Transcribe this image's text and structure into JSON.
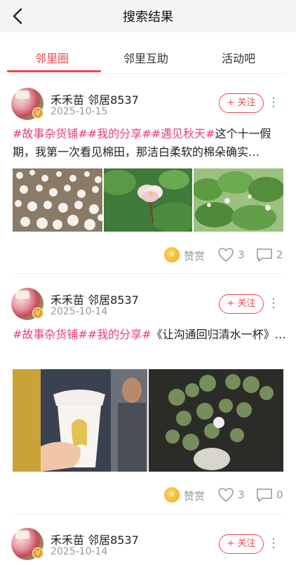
{
  "header": {
    "title": "搜索结果"
  },
  "tabs": [
    {
      "label": "邻里圈"
    },
    {
      "label": "邻里互助"
    },
    {
      "label": "活动吧"
    }
  ],
  "posts": [
    {
      "author": "禾禾苗 邻居8537",
      "date": "2025-10-15",
      "follow_label": "+ 关注",
      "tags": "#故事杂货铺##我的分享##遇见秋天#",
      "text": "这个十一假期，我第一次看见棉田，那洁白柔软的棉朵确实…",
      "reward_label": "赞赏",
      "likes": "3",
      "comments": "2"
    },
    {
      "author": "禾禾苗 邻居8537",
      "date": "2025-10-14",
      "follow_label": "+ 关注",
      "tags": "#故事杂货铺##我的分享#",
      "text": "《让沟通回归清水一杯》…",
      "reward_label": "赞赏",
      "likes": "3",
      "comments": "0"
    },
    {
      "author": "禾禾苗 邻居8537",
      "date": "2025-10-14",
      "follow_label": "+ 关注"
    }
  ],
  "icons": {
    "back": "chevron-left-icon",
    "more": "vertical-dots-icon",
    "reward": "coin-icon",
    "like": "heart-icon",
    "comment": "comment-icon",
    "verified": "verified-badge-icon"
  },
  "colors": {
    "accent": "#f0474e",
    "tag": "#e83d7b",
    "more": "#2fbf71",
    "coin": "#f2a31b"
  }
}
